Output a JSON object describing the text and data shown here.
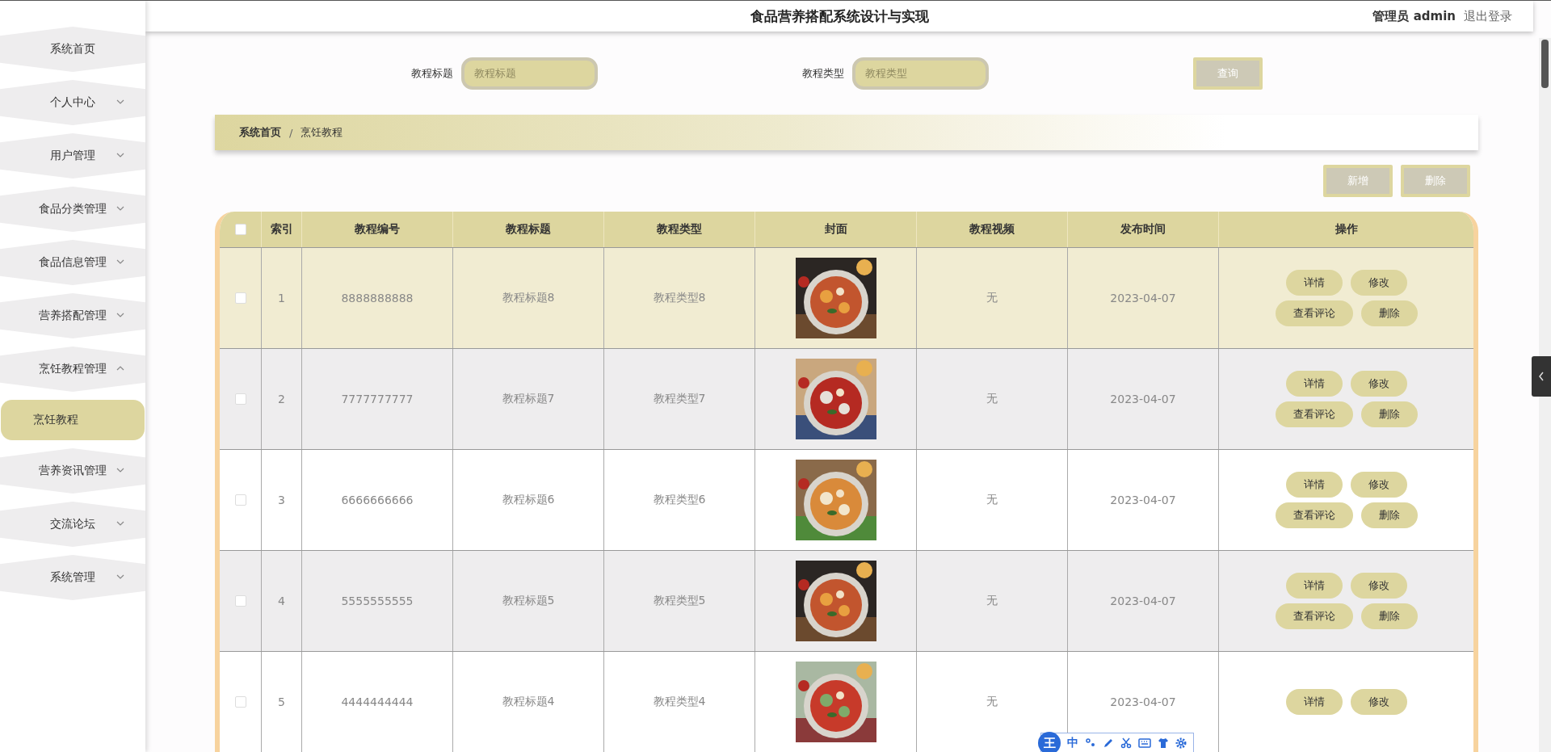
{
  "header": {
    "title": "食品营养搭配系统设计与实现",
    "user_role": "管理员",
    "user_name": "admin",
    "logout": "退出登录"
  },
  "sidebar": {
    "items": [
      {
        "label": "系统首页",
        "has_children": false
      },
      {
        "label": "个人中心",
        "has_children": true,
        "expanded": false
      },
      {
        "label": "用户管理",
        "has_children": true,
        "expanded": false
      },
      {
        "label": "食品分类管理",
        "has_children": true,
        "expanded": false
      },
      {
        "label": "食品信息管理",
        "has_children": true,
        "expanded": false
      },
      {
        "label": "营养搭配管理",
        "has_children": true,
        "expanded": false
      },
      {
        "label": "烹饪教程管理",
        "has_children": true,
        "expanded": true,
        "children": [
          {
            "label": "烹饪教程",
            "selected": true
          }
        ]
      },
      {
        "label": "营养资讯管理",
        "has_children": true,
        "expanded": false
      },
      {
        "label": "交流论坛",
        "has_children": true,
        "expanded": false
      },
      {
        "label": "系统管理",
        "has_children": true,
        "expanded": false
      }
    ]
  },
  "search": {
    "fields": [
      {
        "label": "教程标题",
        "placeholder": "教程标题"
      },
      {
        "label": "教程类型",
        "placeholder": "教程类型"
      }
    ],
    "button": "查询"
  },
  "breadcrumb": {
    "items": [
      "系统首页",
      "烹饪教程"
    ],
    "separator": "/"
  },
  "actions": [
    "新增",
    "删除"
  ],
  "table": {
    "select_all_checked": false,
    "columns": [
      "索引",
      "教程编号",
      "教程标题",
      "教程类型",
      "封面",
      "教程视频",
      "发布时间",
      "操作"
    ],
    "rows": [
      {
        "checked": false,
        "hovered": true,
        "index": "1",
        "code": "8888888888",
        "title": "教程标题8",
        "type": "教程类型8",
        "video": "无",
        "date": "2023-04-07",
        "actions": [
          "详情",
          "修改",
          "查看评论",
          "删除"
        ]
      },
      {
        "checked": false,
        "hovered": false,
        "index": "2",
        "code": "7777777777",
        "title": "教程标题7",
        "type": "教程类型7",
        "video": "无",
        "date": "2023-04-07",
        "actions": [
          "详情",
          "修改",
          "查看评论",
          "删除"
        ]
      },
      {
        "checked": false,
        "hovered": false,
        "index": "3",
        "code": "6666666666",
        "title": "教程标题6",
        "type": "教程类型6",
        "video": "无",
        "date": "2023-04-07",
        "actions": [
          "详情",
          "修改",
          "查看评论",
          "删除"
        ]
      },
      {
        "checked": false,
        "hovered": false,
        "index": "4",
        "code": "5555555555",
        "title": "教程标题5",
        "type": "教程类型5",
        "video": "无",
        "date": "2023-04-07",
        "actions": [
          "详情",
          "修改",
          "查看评论",
          "删除"
        ]
      },
      {
        "checked": false,
        "hovered": false,
        "index": "5",
        "code": "4444444444",
        "title": "教程标题4",
        "type": "教程类型4",
        "video": "无",
        "date": "2023-04-07",
        "actions": [
          "详情",
          "修改"
        ]
      }
    ]
  },
  "ime_toolbar": {
    "logo": "王",
    "mode": "中"
  }
}
